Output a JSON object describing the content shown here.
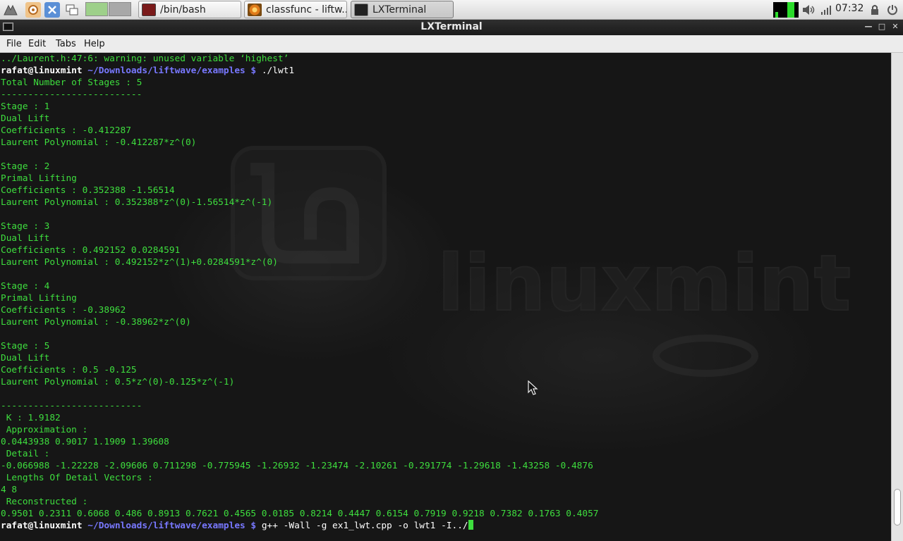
{
  "panel": {
    "launchers": [
      {
        "icon": "mint-menu-icon"
      },
      {
        "icon": "file-manager-icon"
      },
      {
        "icon": "settings-icon"
      },
      {
        "icon": "windows-icon"
      }
    ],
    "workspaces": [
      {
        "icon": "workspace-1-icon",
        "color": "#9ed08a"
      },
      {
        "icon": "workspace-2-icon",
        "color": "#a8a8a8"
      }
    ],
    "tasks": [
      {
        "label": "/bin/bash",
        "icon": "terminal-icon",
        "active": false
      },
      {
        "label": "classfunc - liftw...",
        "icon": "browser-icon",
        "active": false
      },
      {
        "label": "LXTerminal",
        "icon": "terminal-icon",
        "active": true
      }
    ],
    "tray": {
      "monitor_icon": "cpu-monitor-icon",
      "volume_icon": "volume-icon",
      "network_icon": "network-icon",
      "lock_icon": "lock-icon",
      "clock": "07:32"
    }
  },
  "window": {
    "title": "LXTerminal",
    "menu": [
      "File",
      "Edit",
      "Tabs",
      "Help"
    ]
  },
  "colors": {
    "output": "#3ede3e",
    "prompt_user": "#ffffff",
    "prompt_path": "#7878ff"
  },
  "terminal": {
    "lines": [
      {
        "type": "out",
        "text": "../Laurent.h:47:6: warning: unused variable ‘highest’"
      },
      {
        "type": "prompt",
        "user": "rafat@linuxmint",
        "path": "~/Downloads/liftwave/examples $",
        "cmd": " ./lwt1"
      },
      {
        "type": "out",
        "text": "Total Number of Stages : 5"
      },
      {
        "type": "out",
        "text": "--------------------------"
      },
      {
        "type": "out",
        "text": "Stage : 1"
      },
      {
        "type": "out",
        "text": "Dual Lift"
      },
      {
        "type": "out",
        "text": "Coefficients : -0.412287"
      },
      {
        "type": "out",
        "text": "Laurent Polynomial : -0.412287*z^(0)"
      },
      {
        "type": "out",
        "text": ""
      },
      {
        "type": "out",
        "text": "Stage : 2"
      },
      {
        "type": "out",
        "text": "Primal Lifting"
      },
      {
        "type": "out",
        "text": "Coefficients : 0.352388 -1.56514"
      },
      {
        "type": "out",
        "text": "Laurent Polynomial : 0.352388*z^(0)-1.56514*z^(-1)"
      },
      {
        "type": "out",
        "text": ""
      },
      {
        "type": "out",
        "text": "Stage : 3"
      },
      {
        "type": "out",
        "text": "Dual Lift"
      },
      {
        "type": "out",
        "text": "Coefficients : 0.492152 0.0284591"
      },
      {
        "type": "out",
        "text": "Laurent Polynomial : 0.492152*z^(1)+0.0284591*z^(0)"
      },
      {
        "type": "out",
        "text": ""
      },
      {
        "type": "out",
        "text": "Stage : 4"
      },
      {
        "type": "out",
        "text": "Primal Lifting"
      },
      {
        "type": "out",
        "text": "Coefficients : -0.38962"
      },
      {
        "type": "out",
        "text": "Laurent Polynomial : -0.38962*z^(0)"
      },
      {
        "type": "out",
        "text": ""
      },
      {
        "type": "out",
        "text": "Stage : 5"
      },
      {
        "type": "out",
        "text": "Dual Lift"
      },
      {
        "type": "out",
        "text": "Coefficients : 0.5 -0.125"
      },
      {
        "type": "out",
        "text": "Laurent Polynomial : 0.5*z^(0)-0.125*z^(-1)"
      },
      {
        "type": "out",
        "text": ""
      },
      {
        "type": "out",
        "text": "--------------------------"
      },
      {
        "type": "out",
        "text": " K : 1.9182"
      },
      {
        "type": "out",
        "text": " Approximation :"
      },
      {
        "type": "out",
        "text": "0.0443938 0.9017 1.1909 1.39608"
      },
      {
        "type": "out",
        "text": " Detail :"
      },
      {
        "type": "out",
        "text": "-0.066988 -1.22228 -2.09606 0.711298 -0.775945 -1.26932 -1.23474 -2.10261 -0.291774 -1.29618 -1.43258 -0.4876"
      },
      {
        "type": "out",
        "text": " Lengths Of Detail Vectors :"
      },
      {
        "type": "out",
        "text": "4 8"
      },
      {
        "type": "out",
        "text": " Reconstructed :"
      },
      {
        "type": "out",
        "text": "0.9501 0.2311 0.6068 0.486 0.8913 0.7621 0.4565 0.0185 0.8214 0.4447 0.6154 0.7919 0.9218 0.7382 0.1763 0.4057"
      },
      {
        "type": "prompt",
        "user": "rafat@linuxmint",
        "path": "~/Downloads/liftwave/examples $",
        "cmd": " g++ -Wall -g ex1_lwt.cpp -o lwt1 -I../",
        "cursor": true
      }
    ],
    "scroll_position": 0.97
  },
  "wallpaper": {
    "logo_text": "linuxmint"
  }
}
